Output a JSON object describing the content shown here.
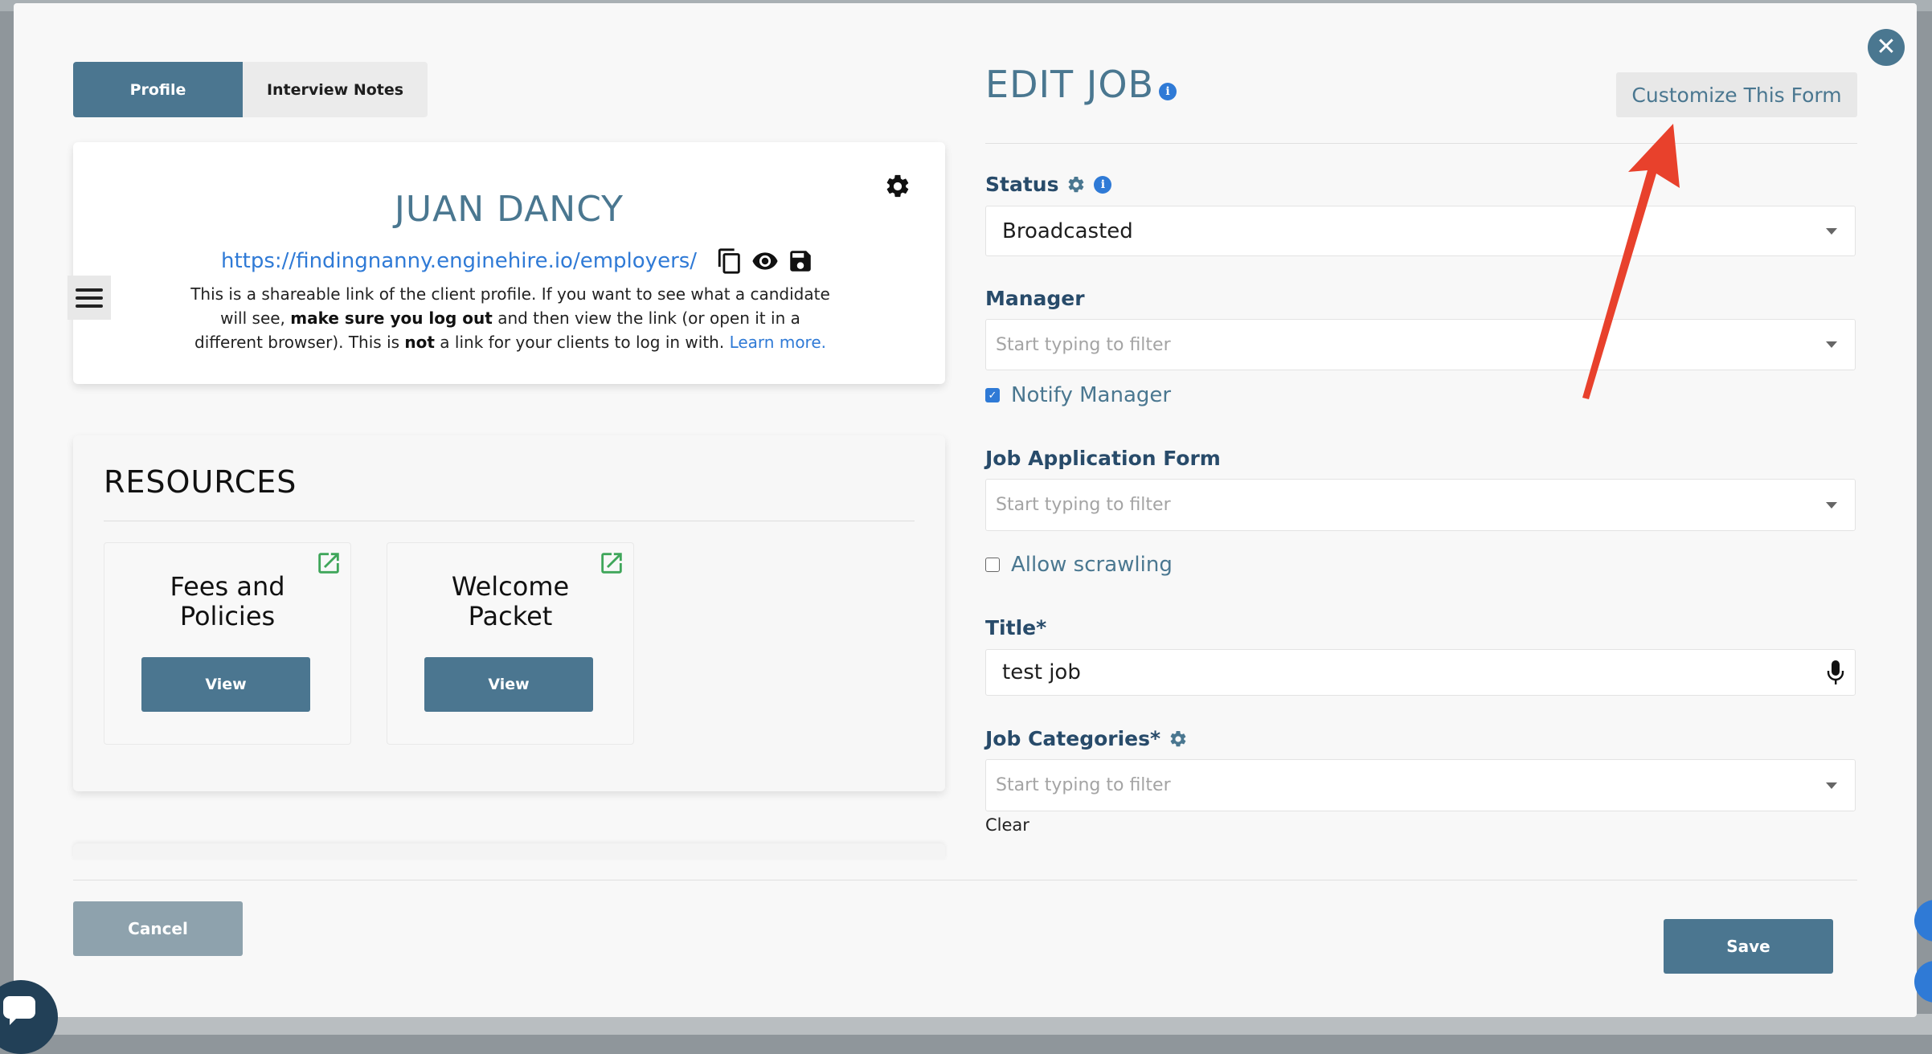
{
  "tabs": {
    "profile": "Profile",
    "interview_notes": "Interview Notes"
  },
  "profile": {
    "name": "JUAN DANCY",
    "link": "https://findingnanny.enginehire.io/employers/",
    "hint_1": "This is a shareable link of the client profile. If you want to see what a candidate will see, ",
    "hint_bold_1": "make sure you log out",
    "hint_2": " and then view the link (or open it in a different browser). This is ",
    "hint_bold_2": "not",
    "hint_3": " a link for your clients to log in with. ",
    "learn_more": "Learn more."
  },
  "resources": {
    "title": "RESOURCES",
    "items": [
      {
        "name_line1": "Fees and",
        "name_line2": "Policies",
        "button": "View"
      },
      {
        "name_line1": "Welcome",
        "name_line2": "Packet",
        "button": "View"
      }
    ]
  },
  "form": {
    "title": "EDIT JOB",
    "customize": "Customize This Form",
    "status_label": "Status",
    "status_value": "Broadcasted",
    "manager_label": "Manager",
    "manager_placeholder": "Start typing to filter",
    "notify_manager": "Notify Manager",
    "notify_checked": true,
    "app_form_label": "Job Application Form",
    "app_form_placeholder": "Start typing to filter",
    "allow_scrawling": "Allow scrawling",
    "allow_scrawling_checked": false,
    "title_label": "Title*",
    "title_value": "test job",
    "categories_label": "Job Categories*",
    "categories_placeholder": "Start typing to filter",
    "clear": "Clear"
  },
  "footer": {
    "cancel": "Cancel",
    "save": "Save"
  },
  "colors": {
    "accent": "#4b7690",
    "link": "#2f7ad6",
    "annotation_arrow": "#e8412c"
  }
}
